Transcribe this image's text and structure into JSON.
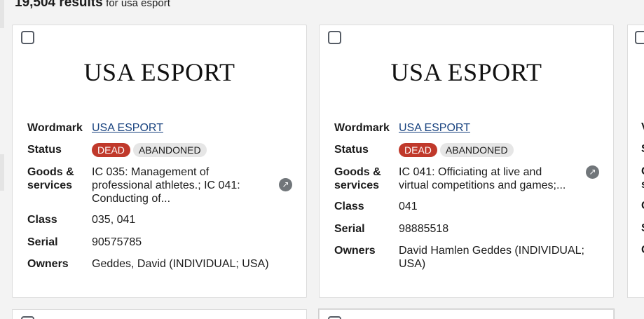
{
  "results": {
    "count": "19,504 results",
    "query_text": "for usa esport"
  },
  "labels": {
    "wordmark": "Wordmark",
    "status": "Status",
    "goods_line1": "Goods &",
    "goods_line2": "services",
    "class": "Class",
    "serial": "Serial",
    "owners": "Owners"
  },
  "cards": [
    {
      "mark_image_text": "USA ESPORT",
      "wordmark": "USA ESPORT",
      "status_dead": "DEAD",
      "status_detail": "ABANDONED",
      "goods_line1": "IC 035: Management of",
      "goods_line2": "professional athletes.; IC 041:",
      "goods_line3": "Conducting of...",
      "class": "035, 041",
      "serial": "90575785",
      "owners_line1": "Geddes, David (INDIVIDUAL; USA)",
      "owners_line2": ""
    },
    {
      "mark_image_text": "USA ESPORT",
      "wordmark": "USA ESPORT",
      "status_dead": "DEAD",
      "status_detail": "ABANDONED",
      "goods_line1": "IC 041: Officiating at live and",
      "goods_line2": "virtual competitions and games;...",
      "goods_line3": "",
      "class": "041",
      "serial": "98885518",
      "owners_line1": "David Hamlen Geddes (INDIVIDUAL;",
      "owners_line2": "USA)"
    }
  ],
  "right_strip_fragments": [
    "V",
    "S",
    "G",
    "s",
    "C",
    "S",
    "C"
  ],
  "icons": {
    "checkbox": "checkbox-icon",
    "open_details": "arrow-up-right-icon"
  },
  "colors": {
    "dead_badge": "#c0392b",
    "link": "#1a4480",
    "abandoned_badge": "#e6e6e6"
  }
}
